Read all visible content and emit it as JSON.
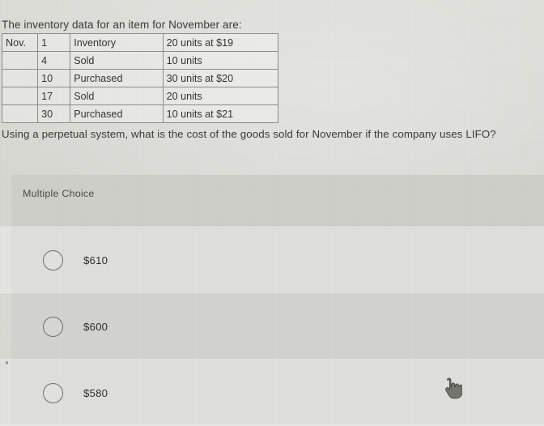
{
  "question": {
    "intro": "The inventory data for an item for November are:",
    "prompt": "Using a perpetual system, what is the cost of the goods sold for November if the company uses LIFO?",
    "type_label": "Multiple Choice"
  },
  "inventory_table": {
    "rows": [
      {
        "month": "Nov.",
        "day": "1",
        "description": "Inventory",
        "quantity": "20 units at $19"
      },
      {
        "month": "",
        "day": "4",
        "description": "Sold",
        "quantity": "10 units"
      },
      {
        "month": "",
        "day": "10",
        "description": "Purchased",
        "quantity": "30 units at $20"
      },
      {
        "month": "",
        "day": "17",
        "description": "Sold",
        "quantity": "20 units"
      },
      {
        "month": "",
        "day": "30",
        "description": "Purchased",
        "quantity": "10 units at $21"
      }
    ]
  },
  "choices": [
    {
      "label": "$610",
      "selected": false
    },
    {
      "label": "$600",
      "selected": false
    },
    {
      "label": "$580",
      "selected": false
    }
  ],
  "cursor": {
    "icon": "pointing-hand-cursor"
  },
  "colors": {
    "page_background": "#d9d9d4",
    "card_background": "#cfcfca",
    "text": "#35352f",
    "table_border": "#8d8d89",
    "radio_border": "#6f6f6b"
  }
}
